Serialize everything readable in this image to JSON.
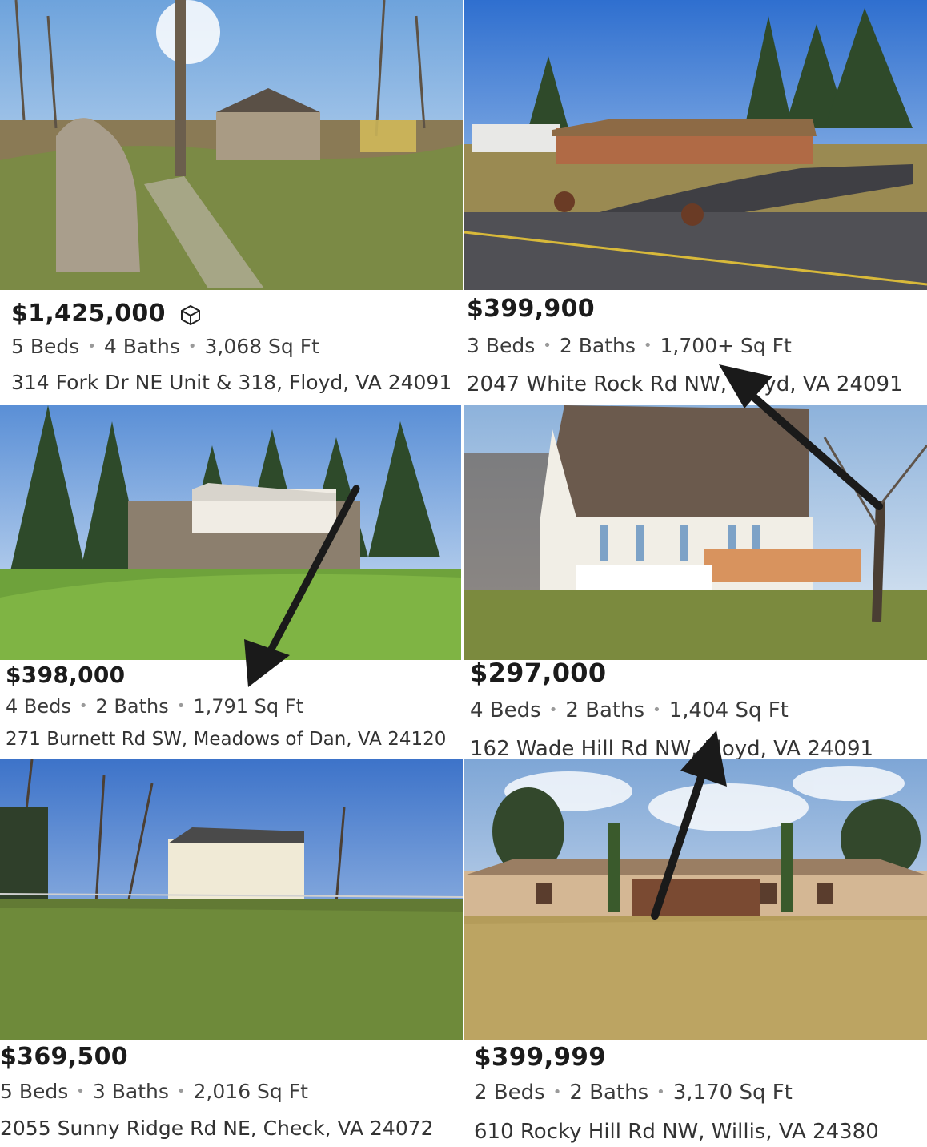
{
  "listings": [
    {
      "price": "$1,425,000",
      "beds": "5 Beds",
      "baths": "4 Baths",
      "sqft": "3,068 Sq Ft",
      "address": "314 Fork Dr NE Unit & 318, Floyd, VA 24091",
      "badge_icon": "3d-tour-icon"
    },
    {
      "price": "$399,900",
      "beds": "3 Beds",
      "baths": "2 Baths",
      "sqft": "1,700+ Sq Ft",
      "address": "2047 White Rock Rd NW, Floyd, VA 24091"
    },
    {
      "price": "$398,000",
      "beds": "4 Beds",
      "baths": "2 Baths",
      "sqft": "1,791 Sq Ft",
      "address": "271 Burnett Rd SW, Meadows of Dan, VA 24120"
    },
    {
      "price": "$297,000",
      "beds": "4 Beds",
      "baths": "2 Baths",
      "sqft": "1,404 Sq Ft",
      "address": "162 Wade Hill Rd NW, Floyd, VA 24091"
    },
    {
      "price": "$369,500",
      "beds": "5 Beds",
      "baths": "3 Baths",
      "sqft": "2,016 Sq Ft",
      "address": "2055 Sunny Ridge Rd NE, Check, VA 24072"
    },
    {
      "price": "$399,999",
      "beds": "2 Beds",
      "baths": "2 Baths",
      "sqft": "3,170 Sq Ft",
      "address": "610 Rocky Hill Rd NW, Willis, VA 24380"
    }
  ],
  "separator": "•",
  "colors": {
    "arrow": "#1a1a1a",
    "sky": "#9cc3ec",
    "grass": "#7d8b3c",
    "text": "#2a2a2a"
  }
}
